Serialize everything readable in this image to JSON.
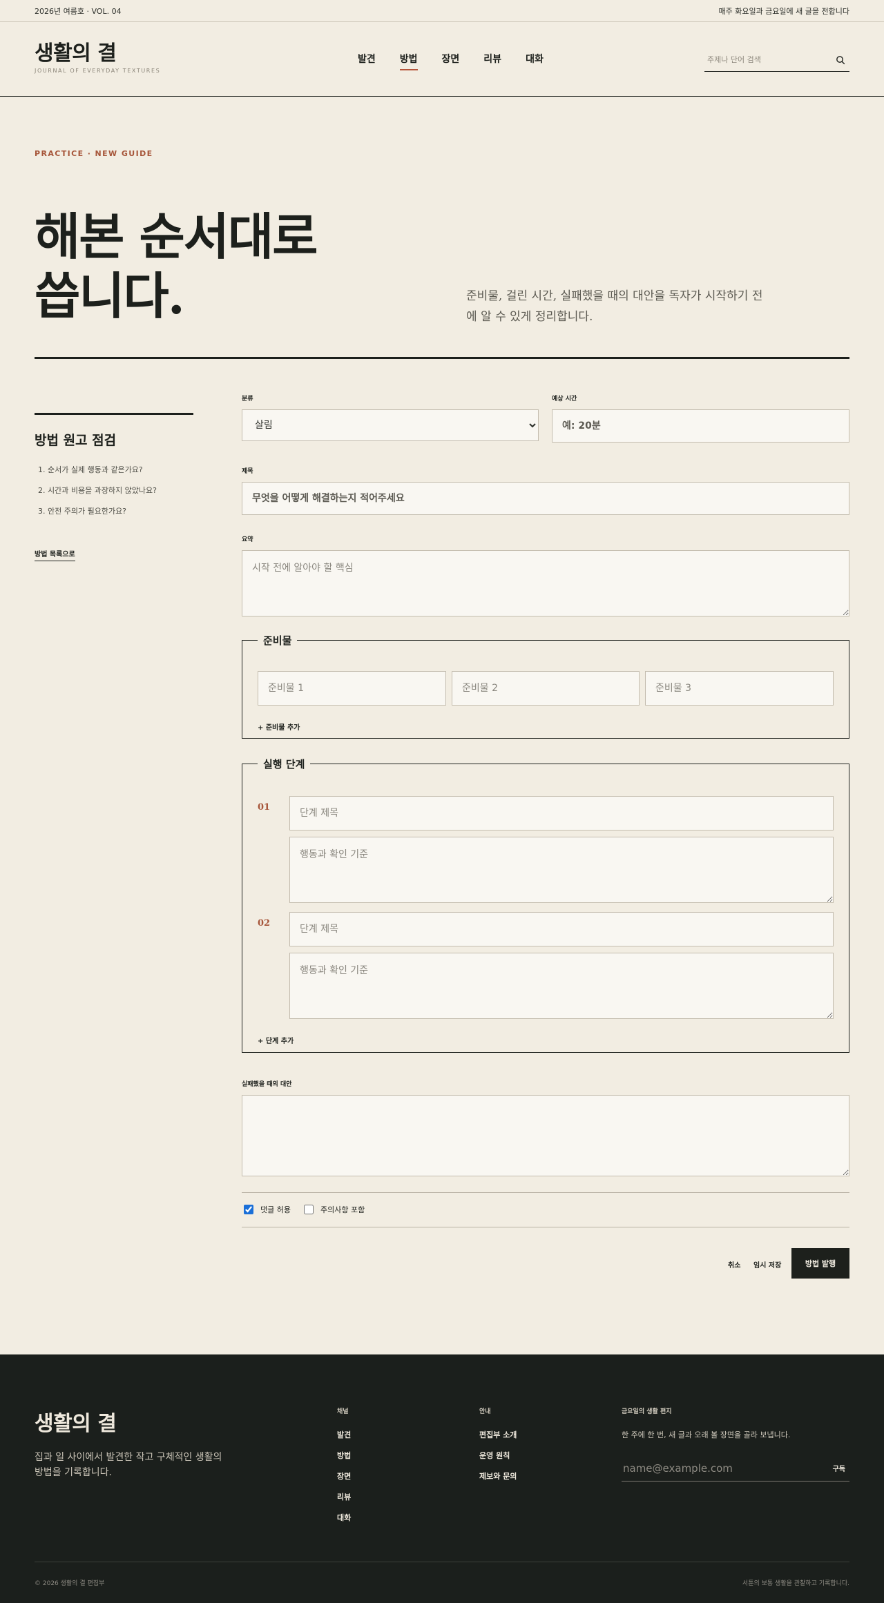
{
  "topbar": {
    "issue": "2026년 여름호 · VOL. 04",
    "schedule": "매주 화요일과 금요일에 새 글을 전합니다"
  },
  "header": {
    "logo_title": "생활의 결",
    "logo_sub": "JOURNAL OF EVERYDAY TEXTURES",
    "nav": [
      "발견",
      "방법",
      "장면",
      "리뷰",
      "대화"
    ],
    "active_nav": "방법",
    "search_placeholder": "주제나 단어 검색"
  },
  "hero": {
    "eyebrow": "PRACTICE · NEW GUIDE",
    "title_line1": "해본 순서대로",
    "title_line2": "씁니다.",
    "description": "준비물, 걸린 시간, 실패했을 때의 대안을 독자가 시작하기 전에 알 수 있게 정리합니다."
  },
  "sidebar": {
    "title": "방법 원고 점검",
    "checklist": [
      "1. 순서가 실제 행동과 같은가요?",
      "2. 시간과 비용을 과장하지 않았나요?",
      "3. 안전 주의가 필요한가요?"
    ],
    "back_link": "방법 목록으로"
  },
  "form": {
    "category_label": "분류",
    "category_value": "살림",
    "time_label": "예상 시간",
    "time_placeholder": "예: 20분",
    "title_label": "제목",
    "title_placeholder": "무엇을 어떻게 해결하는지 적어주세요",
    "summary_label": "요약",
    "summary_placeholder": "시작 전에 알아야 할 핵심",
    "materials": {
      "legend": "준비물",
      "placeholders": [
        "준비물 1",
        "준비물 2",
        "준비물 3"
      ],
      "add": "+ 준비물 추가"
    },
    "steps": {
      "legend": "실행 단계",
      "items": [
        {
          "num": "01",
          "title_placeholder": "단계 제목",
          "body_placeholder": "행동과 확인 기준"
        },
        {
          "num": "02",
          "title_placeholder": "단계 제목",
          "body_placeholder": "행동과 확인 기준"
        }
      ],
      "add": "+ 단계 추가"
    },
    "fallback_label": "실패했을 때의 대안",
    "allow_comments": "댓글 허용",
    "allow_comments_checked": true,
    "include_caution": "주의사항 포함",
    "include_caution_checked": false,
    "cancel": "취소",
    "save_draft": "임시 저장",
    "publish": "방법 발행"
  },
  "footer": {
    "logo": "생활의 결",
    "description": "집과 일 사이에서 발견한 작고 구체적인 생활의 방법을 기록합니다.",
    "channels_head": "채널",
    "channels": [
      "발견",
      "방법",
      "장면",
      "리뷰",
      "대화"
    ],
    "info_head": "안내",
    "info": [
      "편집부 소개",
      "운영 원칙",
      "제보와 문의"
    ],
    "newsletter_head": "금요일의 생활 편지",
    "newsletter_desc": "한 주에 한 번, 새 글과 오래 볼 장면을 골라 보냅니다.",
    "email_placeholder": "name@example.com",
    "subscribe": "구독",
    "copyright": "© 2026 생활의 결 편집부",
    "note": "서툰의 보통 생활을 관찰하고 기록합니다."
  },
  "colors": {
    "background": "#f2ede2",
    "ink": "#1d201c",
    "accent": "#a65539",
    "footer": "#1b1f1c"
  }
}
